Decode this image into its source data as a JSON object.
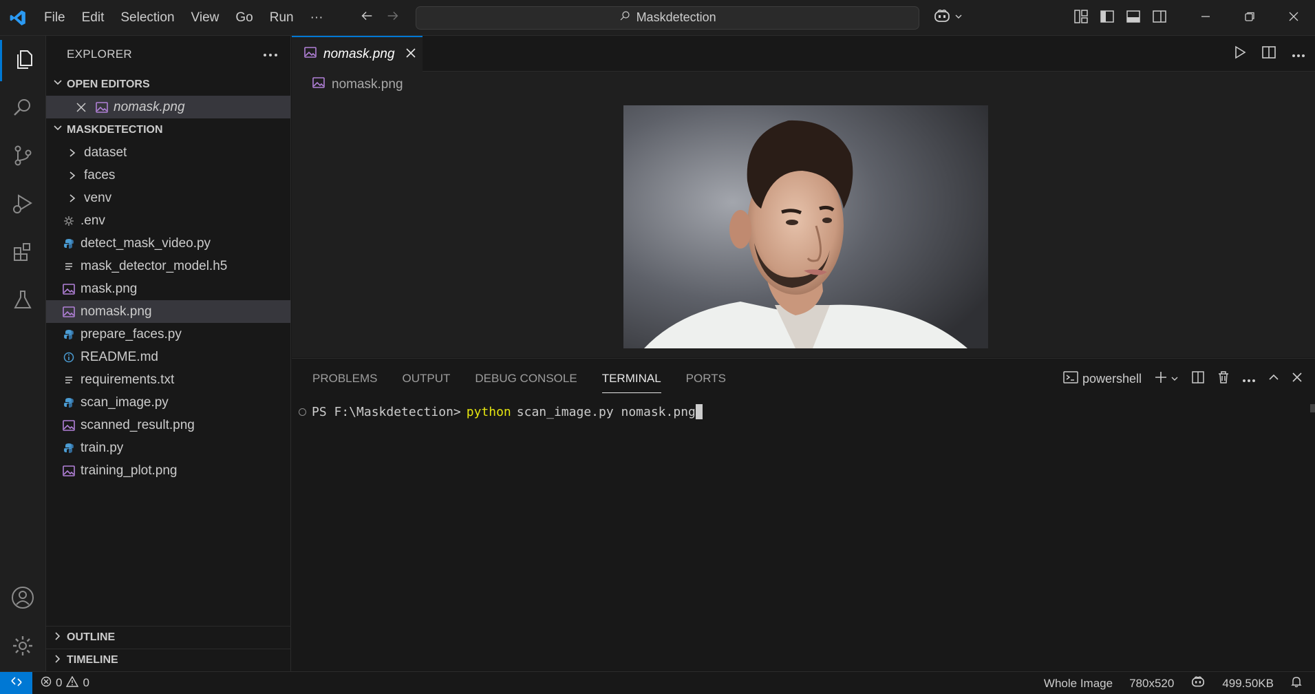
{
  "menu": [
    "File",
    "Edit",
    "Selection",
    "View",
    "Go",
    "Run",
    "···"
  ],
  "search": {
    "text": "Maskdetection"
  },
  "sidebar": {
    "title": "EXPLORER",
    "open_editors_label": "OPEN EDITORS",
    "open_editor_file": "nomask.png",
    "project_label": "MASKDETECTION",
    "folders": [
      "dataset",
      "faces",
      "venv"
    ],
    "files": [
      {
        "name": ".env",
        "icon": "gear-icon"
      },
      {
        "name": "detect_mask_video.py",
        "icon": "python-icon"
      },
      {
        "name": "mask_detector_model.h5",
        "icon": "text-lines-icon"
      },
      {
        "name": "mask.png",
        "icon": "image-icon"
      },
      {
        "name": "nomask.png",
        "icon": "image-icon"
      },
      {
        "name": "prepare_faces.py",
        "icon": "python-icon"
      },
      {
        "name": "README.md",
        "icon": "info-icon"
      },
      {
        "name": "requirements.txt",
        "icon": "text-lines-icon"
      },
      {
        "name": "scan_image.py",
        "icon": "python-icon"
      },
      {
        "name": "scanned_result.png",
        "icon": "image-icon"
      },
      {
        "name": "train.py",
        "icon": "python-icon"
      },
      {
        "name": "training_plot.png",
        "icon": "image-icon"
      }
    ],
    "outline_label": "OUTLINE",
    "timeline_label": "TIMELINE"
  },
  "editor": {
    "tab_label": "nomask.png",
    "breadcrumb": "nomask.png"
  },
  "panel": {
    "tabs": [
      "PROBLEMS",
      "OUTPUT",
      "DEBUG CONSOLE",
      "TERMINAL",
      "PORTS"
    ],
    "active_tab": "TERMINAL",
    "shell": "powershell",
    "prompt": "PS F:\\Maskdetection>",
    "command": "python",
    "args": "scan_image.py nomask.png"
  },
  "status": {
    "errors": "0",
    "warnings": "0",
    "image_scope": "Whole Image",
    "dimensions": "780x520",
    "size": "499.50KB"
  },
  "colors": {
    "accent": "#0078d4",
    "command": "#e5e510",
    "image_icon": "#b180d7",
    "python_icon": "#4b9cd3"
  }
}
